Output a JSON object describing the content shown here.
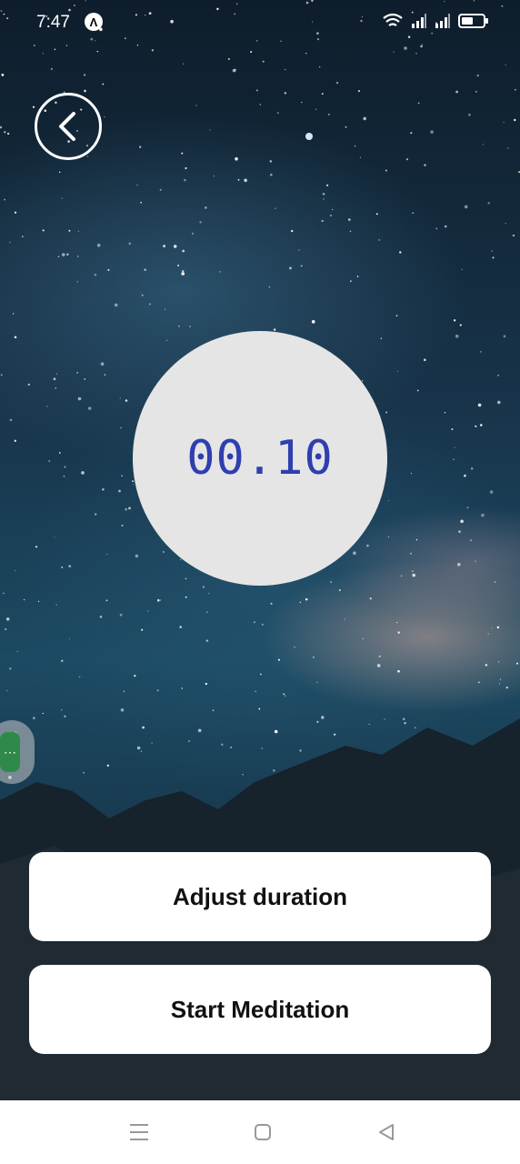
{
  "status_bar": {
    "time": "7:47",
    "notification_icon": "app-notification-icon",
    "icons": [
      "wifi-icon",
      "signal-icon",
      "signal-icon",
      "battery-icon"
    ]
  },
  "header": {
    "back_icon": "chevron-left-icon"
  },
  "timer": {
    "value": "00.10",
    "color": "#2f3fb0"
  },
  "floating_bubble": {
    "label": "⋯",
    "color": "#2f8a4a"
  },
  "buttons": {
    "adjust_label": "Adjust duration",
    "start_label": "Start Meditation"
  },
  "nav_bar": {
    "items": [
      "menu-icon",
      "home-icon",
      "back-triangle-icon"
    ]
  }
}
